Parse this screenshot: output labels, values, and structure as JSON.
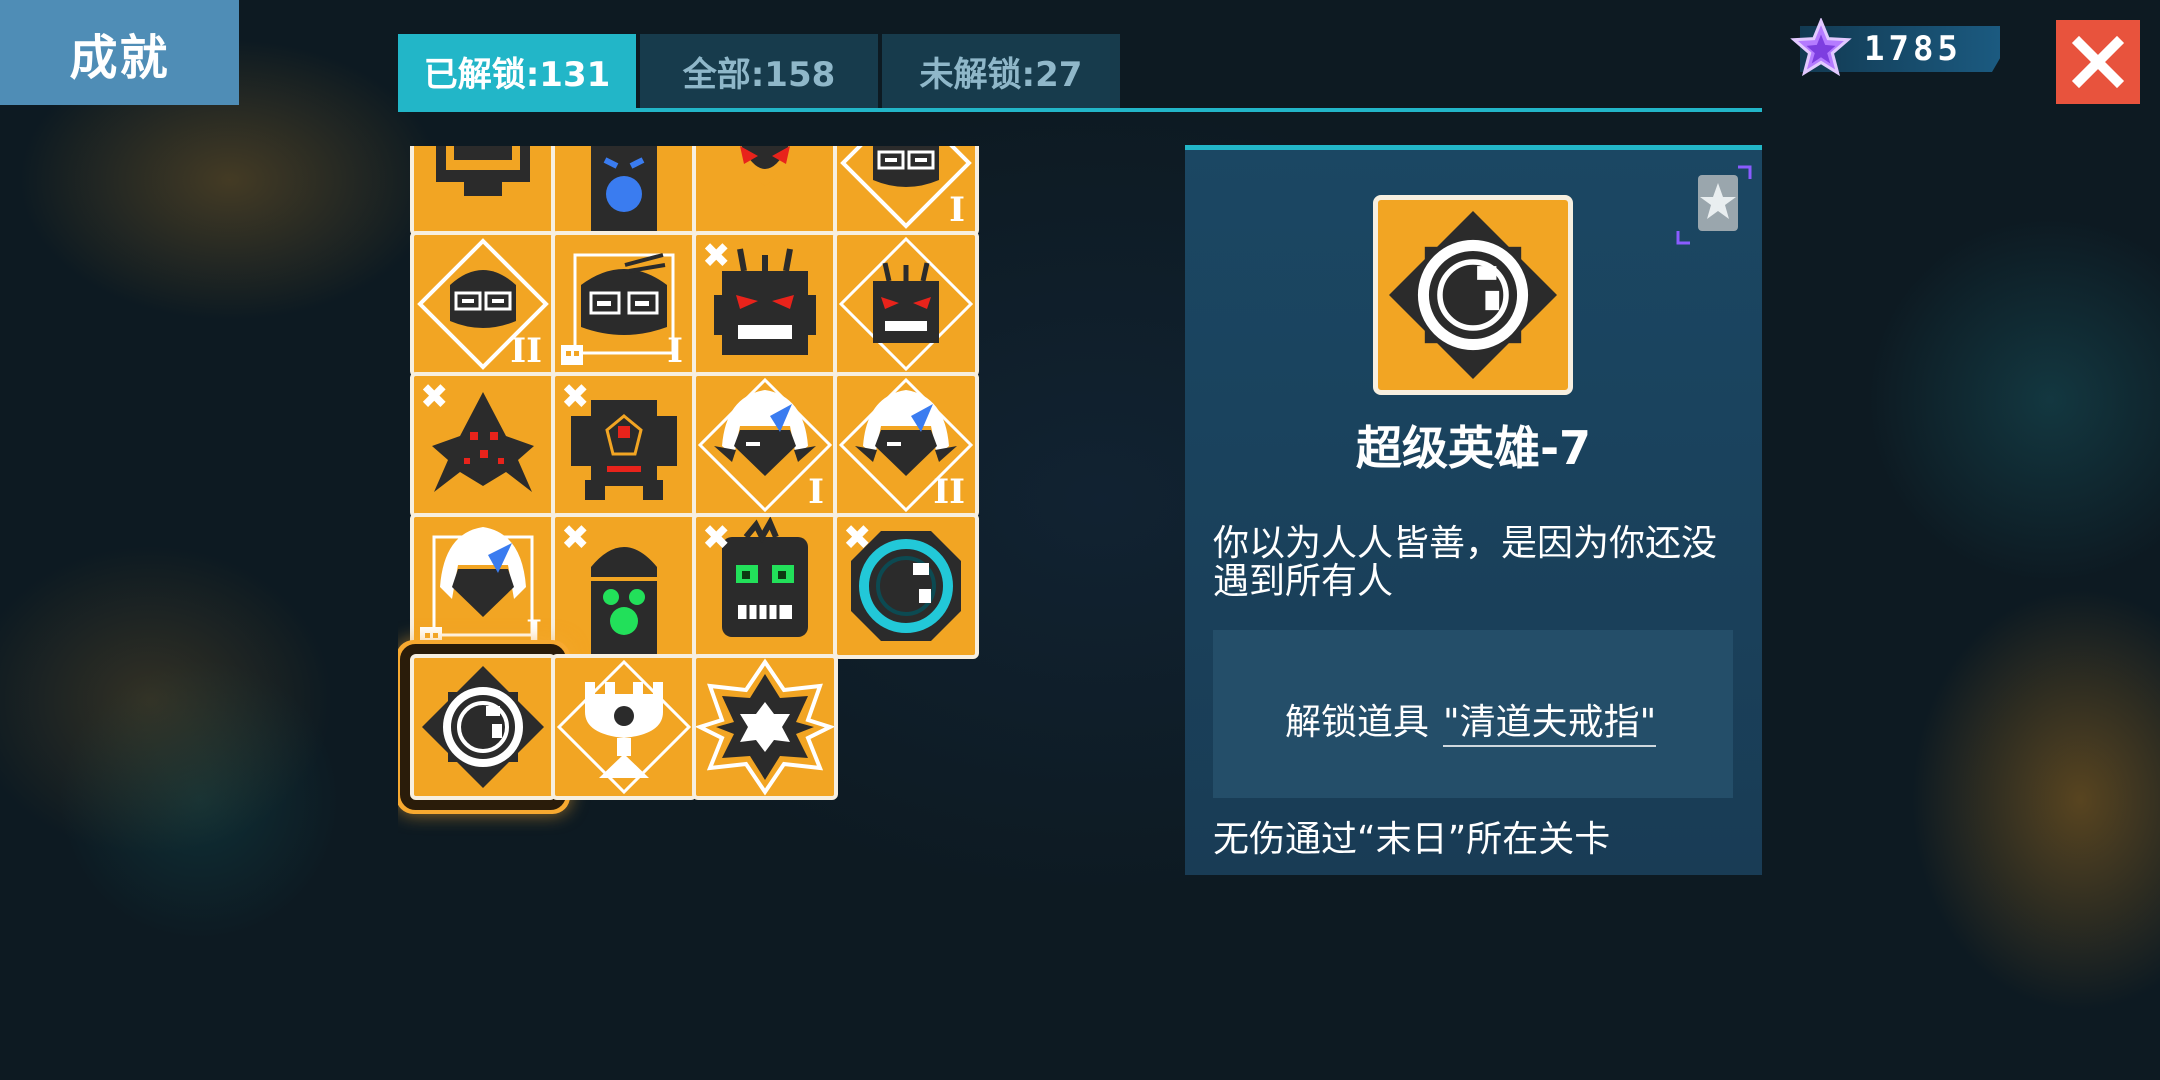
{
  "header": {
    "title": "成就"
  },
  "tabs": [
    {
      "label": "已解锁:131",
      "active": true
    },
    {
      "label": "全部:158",
      "active": false
    },
    {
      "label": "未解锁:27",
      "active": false
    }
  ],
  "currency": {
    "icon": "purple-star-icon",
    "amount": "1785"
  },
  "close_icon": "close-icon",
  "achievements": [
    {
      "icon": "safe-box-icon",
      "numeral": "",
      "crossed": false
    },
    {
      "icon": "crying-mask-icon",
      "numeral": "",
      "crossed": false
    },
    {
      "icon": "horned-demon-icon",
      "numeral": "",
      "crossed": false
    },
    {
      "icon": "goggles-hero-diamond-icon",
      "numeral": "I",
      "crossed": false
    },
    {
      "icon": "goggles-hero-diamond-icon",
      "numeral": "II",
      "crossed": false
    },
    {
      "icon": "goggles-hero-skull-icon",
      "numeral": "I",
      "crossed": false
    },
    {
      "icon": "robot-red-eyes-icon",
      "numeral": "",
      "crossed": true
    },
    {
      "icon": "robot-red-eyes-diamond-icon",
      "numeral": "",
      "crossed": false
    },
    {
      "icon": "spider-creature-icon",
      "numeral": "",
      "crossed": true
    },
    {
      "icon": "mech-red-core-icon",
      "numeral": "",
      "crossed": true
    },
    {
      "icon": "white-hair-hero-diamond-icon",
      "numeral": "I",
      "crossed": false
    },
    {
      "icon": "white-hair-hero-diamond-icon",
      "numeral": "II",
      "crossed": false
    },
    {
      "icon": "white-hair-hero-skull-icon",
      "numeral": "I",
      "crossed": false
    },
    {
      "icon": "green-mask-icon",
      "numeral": "",
      "crossed": true
    },
    {
      "icon": "zombie-green-eyes-icon",
      "numeral": "",
      "crossed": true
    },
    {
      "icon": "cyan-ring-icon",
      "numeral": "",
      "crossed": true
    },
    {
      "icon": "ring-diamond-icon",
      "numeral": "",
      "crossed": false,
      "selected": true
    },
    {
      "icon": "trophy-diamond-icon",
      "numeral": "",
      "crossed": false
    },
    {
      "icon": "star-octagon-icon",
      "numeral": "",
      "crossed": false
    }
  ],
  "detail": {
    "emblem_icon": "ring-diamond-icon",
    "badge_icon": "silver-star-badge-icon",
    "name": "超级英雄-7",
    "description": "你以为人人皆善，是因为你还没遇到所有人",
    "reward_prefix": "解锁道具",
    "reward_item": "\"清道夫戒指\"",
    "condition": "无伤通过“末日”所在关卡"
  },
  "colors": {
    "tile": "#f2a523",
    "tab_active": "#22b6c8",
    "tab_inactive": "#173b4c",
    "close": "#e8533d",
    "title_bg": "#4f8db6",
    "panel": "#1b4763"
  }
}
